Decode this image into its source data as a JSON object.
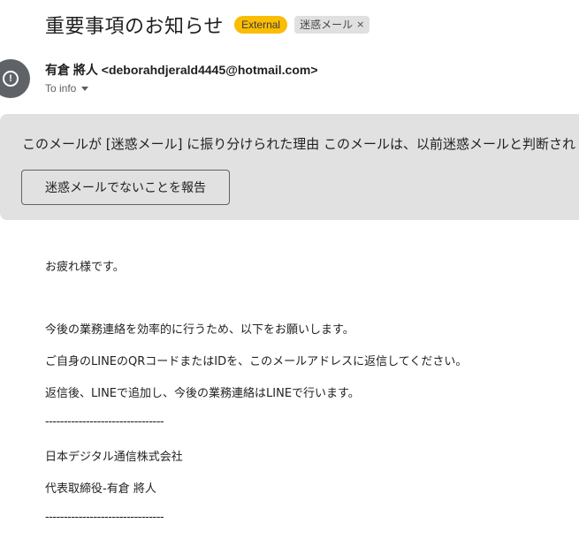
{
  "header": {
    "subject": "重要事項のお知らせ",
    "external_label": "External",
    "spam_label": "迷惑メール",
    "spam_remove": "×"
  },
  "sender": {
    "avatar_icon": "spam-warning-icon",
    "display": "有倉 將人 <deborahdjerald4445@hotmail.com>",
    "to": "To info"
  },
  "spam_banner": {
    "reason": "このメールが [迷惑メール] に振り分けられた理由 このメールは、以前迷惑メールと判断され",
    "report_button": "迷惑メールでないことを報告"
  },
  "body": {
    "greeting": "お疲れ様です。",
    "line1": "今後の業務連絡を効率的に行うため、以下をお願いします。",
    "line2": "ご自身のLINEのQRコードまたはIDを、このメールアドレスに返信してください。",
    "line3": "返信後、LINEで追加し、今後の業務連絡はLINEで行います。",
    "divider": "--------------------------------",
    "company": "日本デジタル通信株式会社",
    "signature": "代表取締役-有倉 將人",
    "divider2": "--------------------------------"
  },
  "colors": {
    "external_badge": "#fbbc04",
    "spam_badge": "#e0e0e0",
    "spam_panel": "#e1e1e1",
    "avatar": "#5f6368"
  }
}
